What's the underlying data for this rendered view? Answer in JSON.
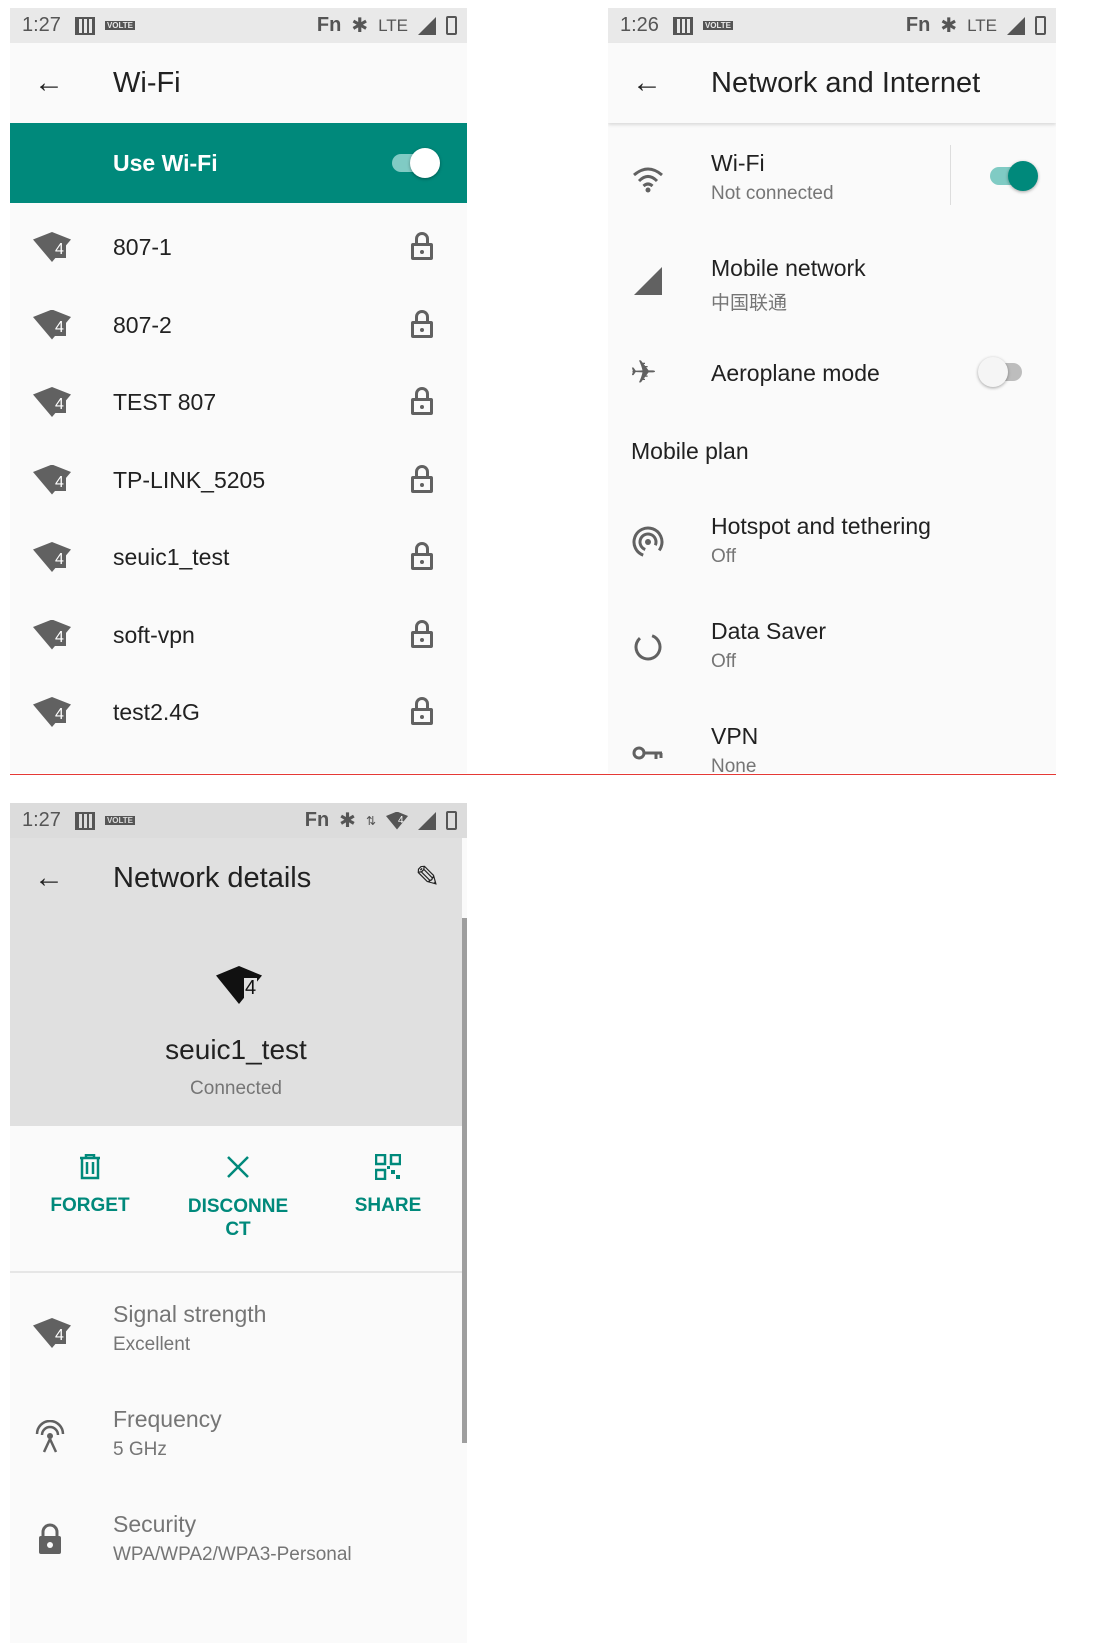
{
  "colors": {
    "accent": "#00897b",
    "toggle_on_track": "#80cbc4",
    "separator": "#e53935"
  },
  "wifi_screen": {
    "status": {
      "time": "1:27",
      "volte": "VOLTE",
      "fn": "Fn",
      "net": "LTE"
    },
    "title": "Wi-Fi",
    "use_wifi_label": "Use Wi-Fi",
    "use_wifi_on": true,
    "networks": [
      {
        "ssid": "807-1",
        "level": "4"
      },
      {
        "ssid": "807-2",
        "level": "4"
      },
      {
        "ssid": "TEST 807",
        "level": "4"
      },
      {
        "ssid": "TP-LINK_5205",
        "level": "4"
      },
      {
        "ssid": "seuic1_test",
        "level": "4"
      },
      {
        "ssid": "soft-vpn",
        "level": "4"
      },
      {
        "ssid": "test2.4G",
        "level": "4"
      }
    ]
  },
  "network_screen": {
    "status": {
      "time": "1:26",
      "volte": "VOLTE",
      "fn": "Fn",
      "net": "LTE"
    },
    "title": "Network and Internet",
    "items": [
      {
        "title": "Wi-Fi",
        "subtitle": "Not connected",
        "icon": "wifi-icon",
        "toggle": true
      },
      {
        "title": "Mobile network",
        "subtitle": "中国联通",
        "icon": "cellular-icon"
      },
      {
        "title": "Aeroplane mode",
        "subtitle": "",
        "icon": "airplane-icon",
        "toggle": false
      },
      {
        "title": "Mobile plan",
        "subtitle": ""
      },
      {
        "title": "Hotspot and tethering",
        "subtitle": "Off",
        "icon": "hotspot-icon"
      },
      {
        "title": "Data Saver",
        "subtitle": "Off",
        "icon": "data-saver-icon"
      },
      {
        "title": "VPN",
        "subtitle": "None",
        "icon": "vpn-key-icon"
      }
    ]
  },
  "details_screen": {
    "status": {
      "time": "1:27",
      "volte": "VOLTE",
      "fn": "Fn",
      "level": "4"
    },
    "title": "Network details",
    "ssid": "seuic1_test",
    "level": "4",
    "state": "Connected",
    "actions": [
      {
        "label": "FORGET",
        "icon": "delete-icon"
      },
      {
        "label": "DISCONNE\nCT",
        "icon": "close-icon"
      },
      {
        "label": "SHARE",
        "icon": "qr-code-icon"
      }
    ],
    "info": [
      {
        "title": "Signal strength",
        "value": "Excellent",
        "icon": "wifi-signal-icon"
      },
      {
        "title": "Frequency",
        "value": "5 GHz",
        "icon": "antenna-icon"
      },
      {
        "title": "Security",
        "value": "WPA/WPA2/WPA3-Personal",
        "icon": "lock-icon"
      }
    ]
  }
}
